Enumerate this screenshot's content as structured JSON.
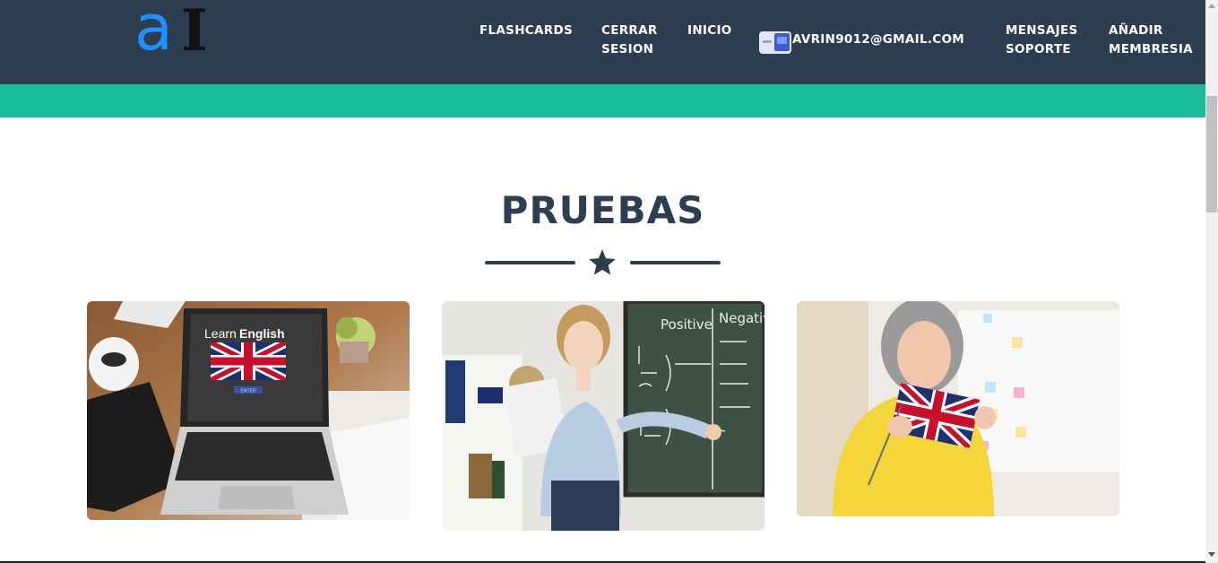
{
  "navbar": {
    "logo": {
      "letter1": "a",
      "letter2": "I"
    },
    "links": {
      "flashcards": "FLASHCARDS",
      "cerrar_line1": "CERRAR",
      "cerrar_line2": "SESION",
      "inicio": "INICIO",
      "user_email": "AVRIN9012@GMAIL.COM",
      "mensajes_line1": "MENSAJES",
      "mensajes_line2": "SOPORTE",
      "anadir_line1": "AÑADIR",
      "anadir_line2": "MEMBRESIA"
    }
  },
  "main": {
    "title": "PRUEBAS",
    "cards": [
      {
        "image": "laptop-learn-english",
        "screen_text_1": "Learn",
        "screen_text_2": "English",
        "button_text": "ENTER"
      },
      {
        "image": "teacher-chalkboard",
        "board_title_1": "Positive",
        "board_title_2": "Negative"
      },
      {
        "image": "woman-uk-flag"
      }
    ]
  },
  "colors": {
    "navbar": "#2c3e50",
    "accent": "#1abc9c",
    "title": "#2c3e50",
    "logo_blue": "#1e90ff"
  },
  "icons": [
    "star-icon",
    "avatar-icon"
  ]
}
